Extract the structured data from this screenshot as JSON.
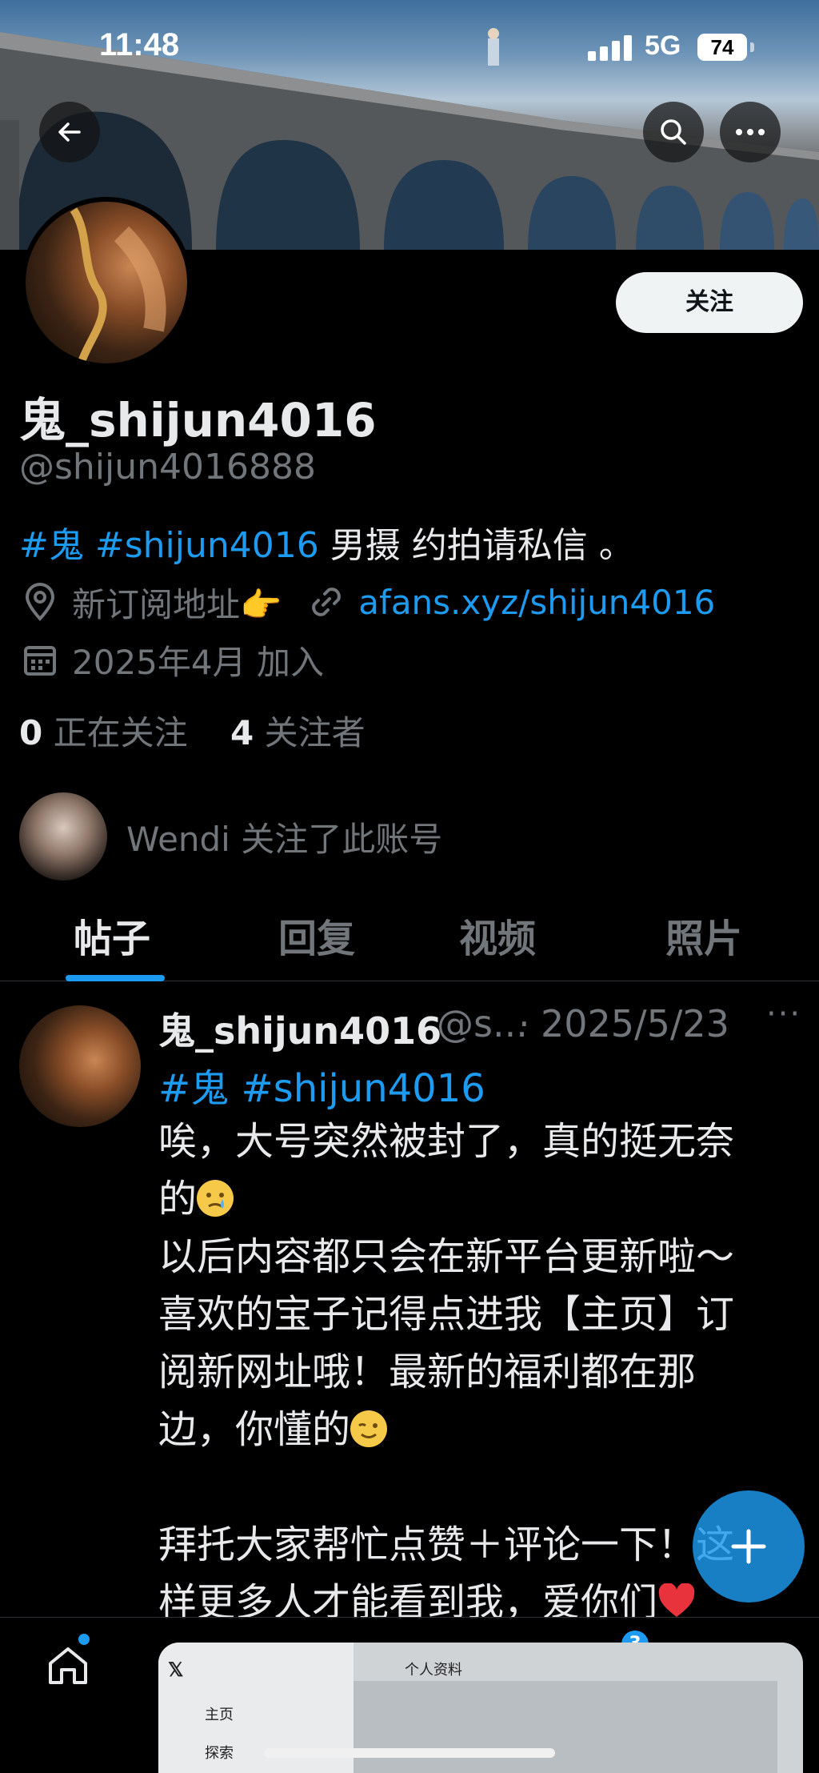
{
  "status_bar": {
    "time": "11:48",
    "network": "5G",
    "battery": "74"
  },
  "profile": {
    "display_name": "鬼_shijun4016",
    "handle": "@shijun4016888",
    "follow_button": "关注",
    "bio_tags": "#鬼 #shijun4016",
    "bio_text": " 男摄 约拍请私信 。",
    "location": "新订阅地址👉",
    "website": "afans.xyz/shijun4016",
    "joined": "2025年4月 加入",
    "following_count": "0",
    "following_label": "正在关注",
    "followers_count": "4",
    "followers_label": "关注者",
    "mutual_follow": "Wendi 关注了此账号"
  },
  "tabs": [
    {
      "label": "帖子",
      "active": true
    },
    {
      "label": "回复",
      "active": false
    },
    {
      "label": "视频",
      "active": false
    },
    {
      "label": "照片",
      "active": false
    }
  ],
  "post": {
    "author_name": "鬼_shijun4016",
    "author_handle": "@s...",
    "separator": "·",
    "date": "2025/5/23",
    "more": "···",
    "tags": "#鬼 #shijun4016",
    "lines": [
      "唉，大号突然被封了，真的挺无奈",
      "的",
      "以后内容都只会在新平台更新啦～",
      "喜欢的宝子记得点进我【主页】订",
      "阅新网址哦！最新的福利都在那",
      "边，你懂的",
      "",
      "拜托大家帮忙点赞＋评论一下！这",
      "样更多人才能看到我，爱你们"
    ]
  },
  "bottom_nav": {
    "items": [
      "home-icon",
      "search-icon",
      "grok-icon",
      "play-icon",
      "notifications-icon",
      "messages-icon"
    ],
    "notifications_badge": "3",
    "preview": {
      "title": "个人资料",
      "menu_home": "主页",
      "menu_explore": "探索"
    }
  },
  "colors": {
    "accent": "#1d9bf0",
    "muted": "#71767b",
    "text": "#e7e9ea",
    "background": "#000000"
  }
}
